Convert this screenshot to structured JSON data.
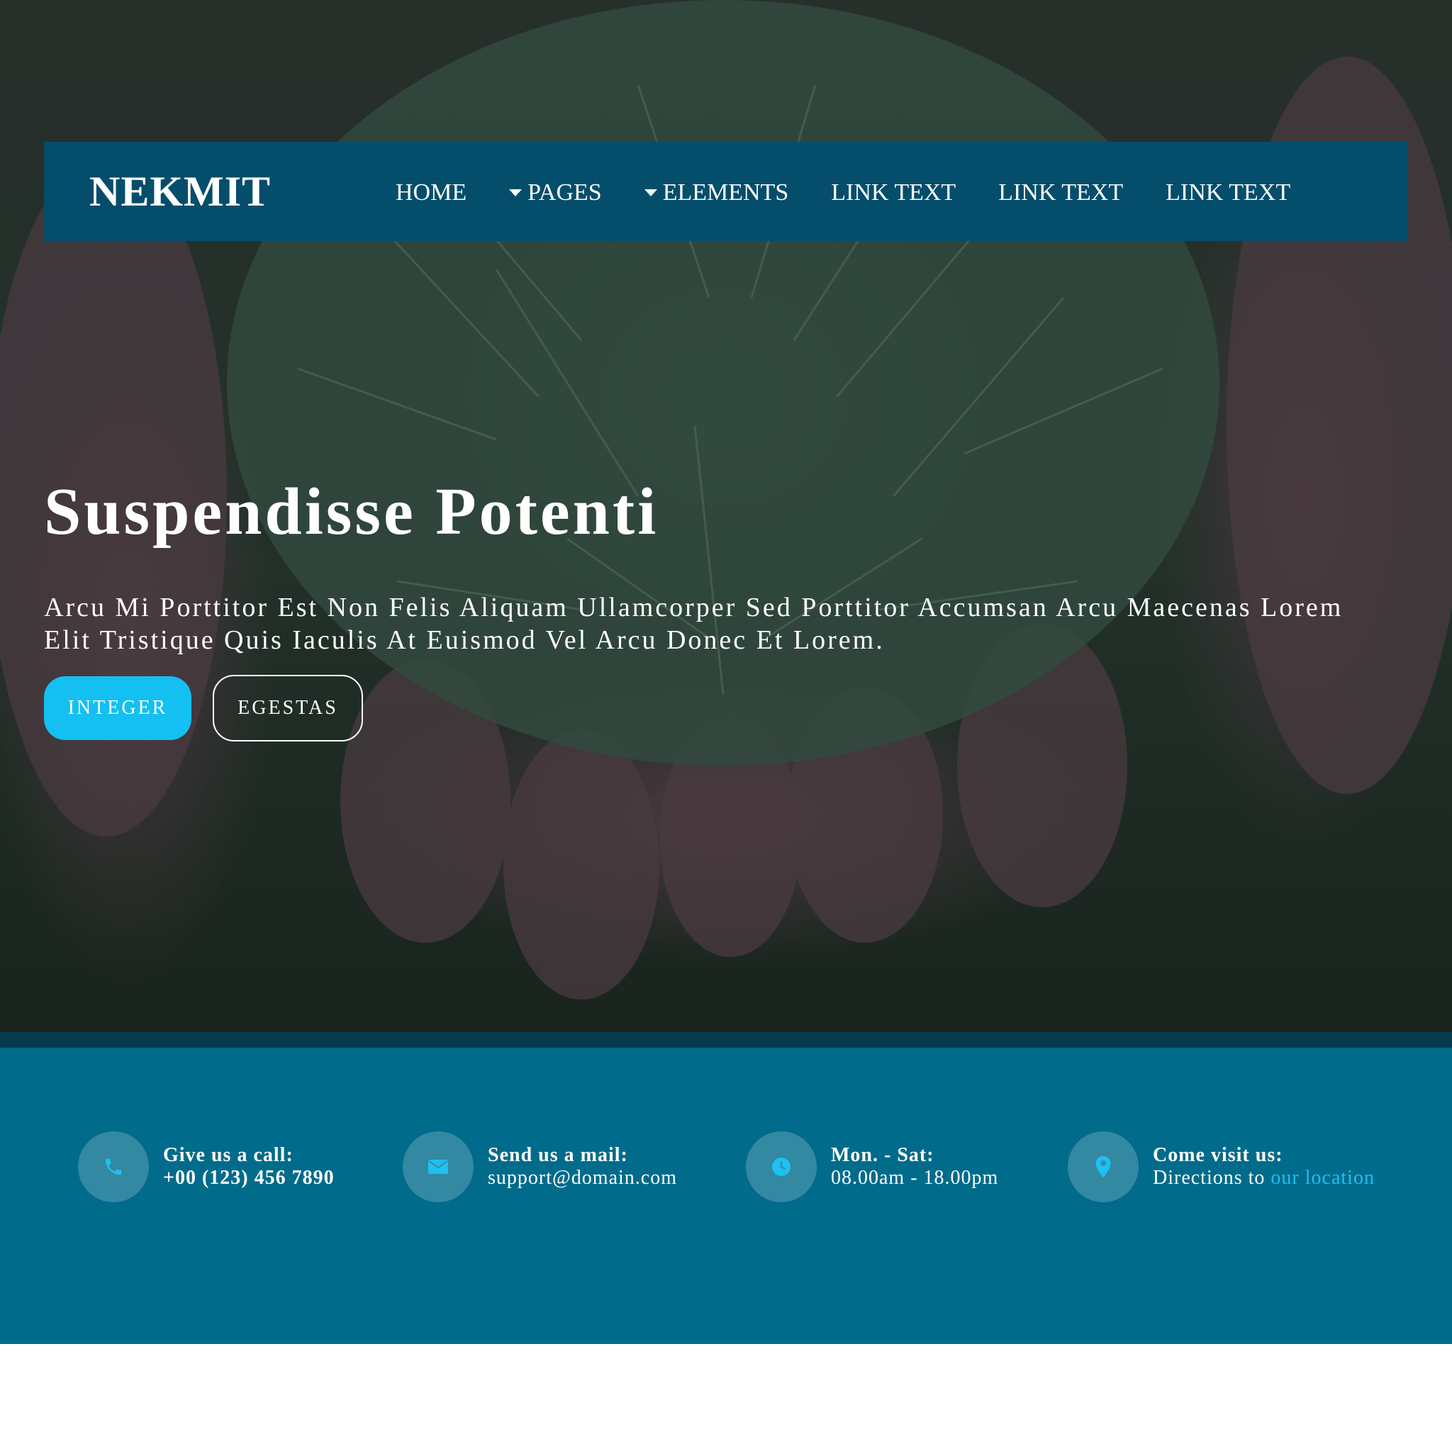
{
  "brand": "NEKMIT",
  "nav": [
    {
      "label": "HOME",
      "dropdown": false
    },
    {
      "label": "PAGES",
      "dropdown": true
    },
    {
      "label": "ELEMENTS",
      "dropdown": true
    },
    {
      "label": "LINK TEXT",
      "dropdown": false
    },
    {
      "label": "LINK TEXT",
      "dropdown": false
    },
    {
      "label": "LINK TEXT",
      "dropdown": false
    }
  ],
  "hero": {
    "title": "Suspendisse Potenti",
    "text": "Arcu Mi Porttitor Est Non Felis Aliquam Ullamcorper Sed Porttitor Accumsan Arcu Maecenas Lorem Elit Tristique Quis Iaculis At Euismod Vel Arcu Donec Et Lorem.",
    "primary_button": "INTEGER",
    "secondary_button": "EGESTAS"
  },
  "contact": {
    "call": {
      "label": "Give us a call:",
      "value": "+00 (123) 456 7890",
      "icon": "phone-icon"
    },
    "mail": {
      "label": "Send us a mail:",
      "value": "support@domain.com",
      "icon": "envelope-icon"
    },
    "hours": {
      "label": "Mon. - Sat:",
      "value": "08.00am - 18.00pm",
      "icon": "clock-icon"
    },
    "visit": {
      "label": "Come visit us:",
      "value_prefix": "Directions to ",
      "link": "our location",
      "icon": "map-pin-icon"
    }
  },
  "colors": {
    "navbar": "#054e6b",
    "primary_button": "#14bff1",
    "contact_bg": "#016b8b",
    "accent": "#1dc1f2"
  }
}
